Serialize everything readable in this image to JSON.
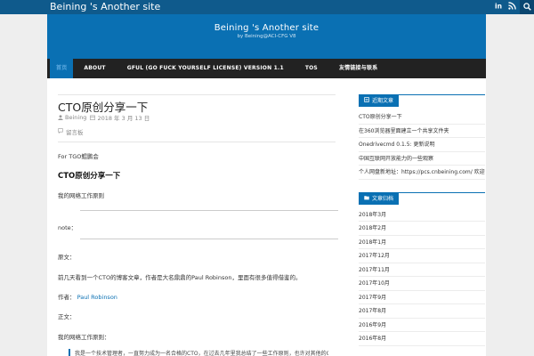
{
  "topbar": {
    "site_title": "Beining 's Another site",
    "icons": [
      "linkedin-icon",
      "rss-icon",
      "search-icon"
    ]
  },
  "header": {
    "title": "Beining 's Another site",
    "tagline": "by Beining@ACI-CFG V8"
  },
  "nav": {
    "items": [
      {
        "label": "首页"
      },
      {
        "label": "ABOUT"
      },
      {
        "label": "GFUL (GO FUCK YOURSELF LICENSE) VERSION 1.1"
      },
      {
        "label": "TOS"
      },
      {
        "label": "友情链接与联系"
      }
    ]
  },
  "post": {
    "title": "CTO原创分享一下",
    "author": "Beining",
    "date": "2018 年 3 月 13 日",
    "comment": "留言板",
    "intro": "For TGO鲲鹏会",
    "heading": "CTO原创分享一下",
    "subheading": "我的网络工作原则",
    "note": "note：",
    "label1": "原文：",
    "line1": "前几天看到一个CTO的博客文章，作者是大名鼎鼎的Paul Robinson，里面有很多值得借鉴的。",
    "author_label": "作者：",
    "author_link": "Paul Robinson",
    "label2": "正文：",
    "label3": "我的网络工作原则：",
    "quote": "我是一个技术管理者，一直努力成为一名合格的CTO，在过去几年里我总结了一些工作原则，也许对其他的CTO也有一些参考意义。"
  },
  "sidebar": {
    "recent": {
      "title": "近期文章",
      "items": [
        "CTO原创分享一下",
        "在360浏览器里面建立一个共享文件夹",
        "Onedrivecmd 0.1.5: 更新说明",
        "中国互联网开放能力的一些观察",
        "个人网盘新地址：https://pcs.cnbeining.com/ 欢迎大家使用"
      ]
    },
    "archives": {
      "title": "文章归档",
      "items": [
        "2018年3月",
        "2018年2月",
        "2018年1月",
        "2017年12月",
        "2017年11月",
        "2017年10月",
        "2017年9月",
        "2017年8月",
        "2016年9月",
        "2016年8月"
      ]
    }
  }
}
